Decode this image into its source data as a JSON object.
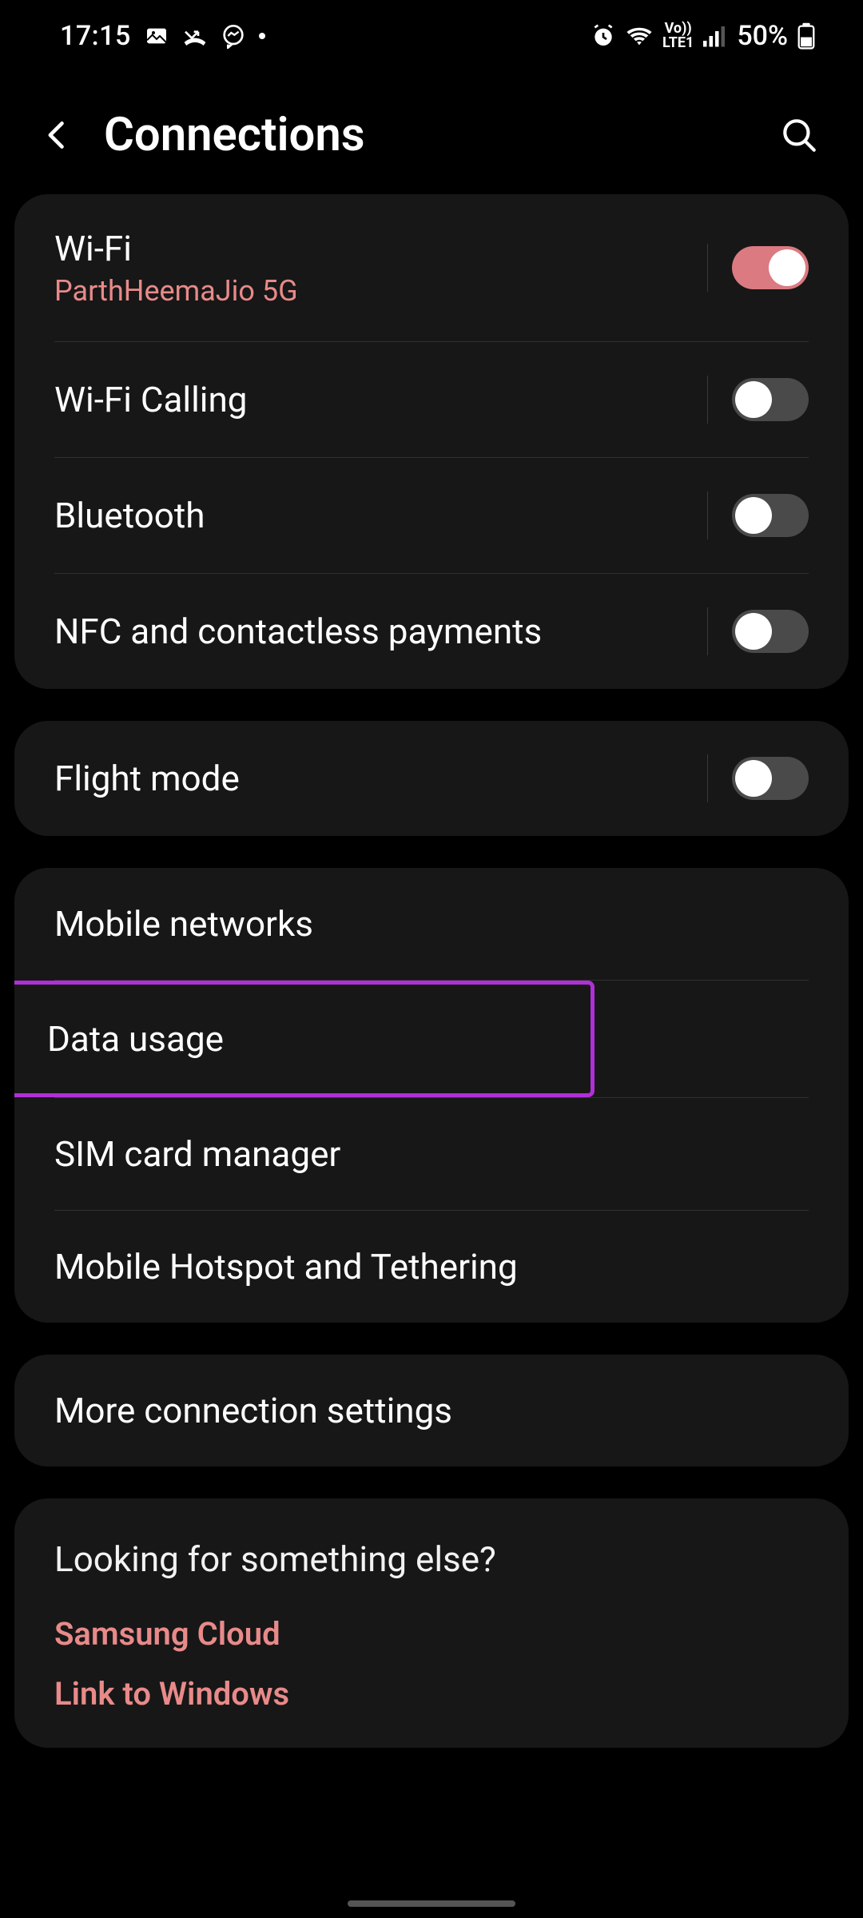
{
  "status": {
    "time": "17:15",
    "battery": "50%"
  },
  "header": {
    "title": "Connections"
  },
  "groups": [
    {
      "rows": [
        {
          "title": "Wi-Fi",
          "subtitle": "ParthHeemaJio 5G",
          "toggle": "on"
        },
        {
          "title": "Wi-Fi Calling",
          "toggle": "off"
        },
        {
          "title": "Bluetooth",
          "toggle": "off"
        },
        {
          "title": "NFC and contactless payments",
          "toggle": "off"
        }
      ]
    },
    {
      "rows": [
        {
          "title": "Flight mode",
          "toggle": "off"
        }
      ]
    },
    {
      "rows": [
        {
          "title": "Mobile networks"
        },
        {
          "title": "Data usage",
          "highlight": true
        },
        {
          "title": "SIM card manager"
        },
        {
          "title": "Mobile Hotspot and Tethering"
        }
      ]
    },
    {
      "rows": [
        {
          "title": "More connection settings"
        }
      ]
    }
  ],
  "suggestions": {
    "title": "Looking for something else?",
    "links": [
      "Samsung Cloud",
      "Link to Windows"
    ]
  }
}
